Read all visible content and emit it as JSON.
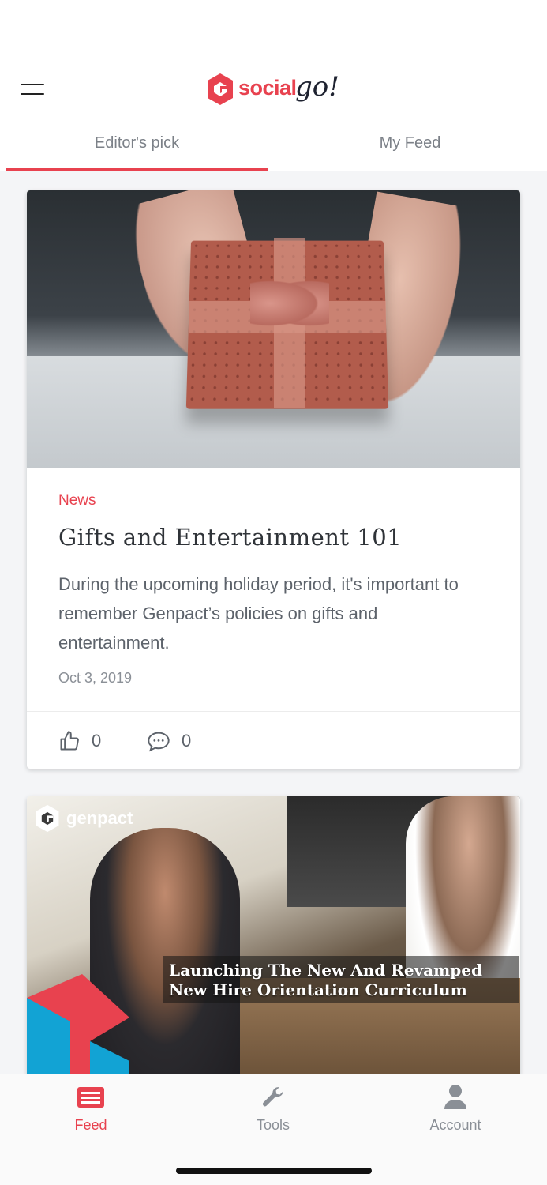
{
  "header": {
    "logo_word": "social",
    "logo_go": "go!",
    "tabs": [
      {
        "label": "Editor's pick",
        "active": true
      },
      {
        "label": "My Feed",
        "active": false
      }
    ]
  },
  "feed": {
    "items": [
      {
        "category": "News",
        "title": "Gifts and Entertainment 101",
        "excerpt": "During the upcoming holiday period, it's important to remember Genpact’s policies on gifts and entertainment.",
        "date": "Oct 3, 2019",
        "likes": "0",
        "comments": "0"
      },
      {
        "brand": "genpact",
        "overlay_title_line1": "Launching The New And Revamped",
        "overlay_title_line2": "New Hire Orientation Curriculum"
      }
    ]
  },
  "bottom_nav": {
    "items": [
      {
        "label": "Feed",
        "icon": "feed-icon",
        "active": true
      },
      {
        "label": "Tools",
        "icon": "wrench-icon",
        "active": false
      },
      {
        "label": "Account",
        "icon": "user-icon",
        "active": false
      }
    ]
  },
  "colors": {
    "accent": "#e8424f",
    "muted_text": "#8a8f96",
    "background": "#f4f5f7"
  }
}
